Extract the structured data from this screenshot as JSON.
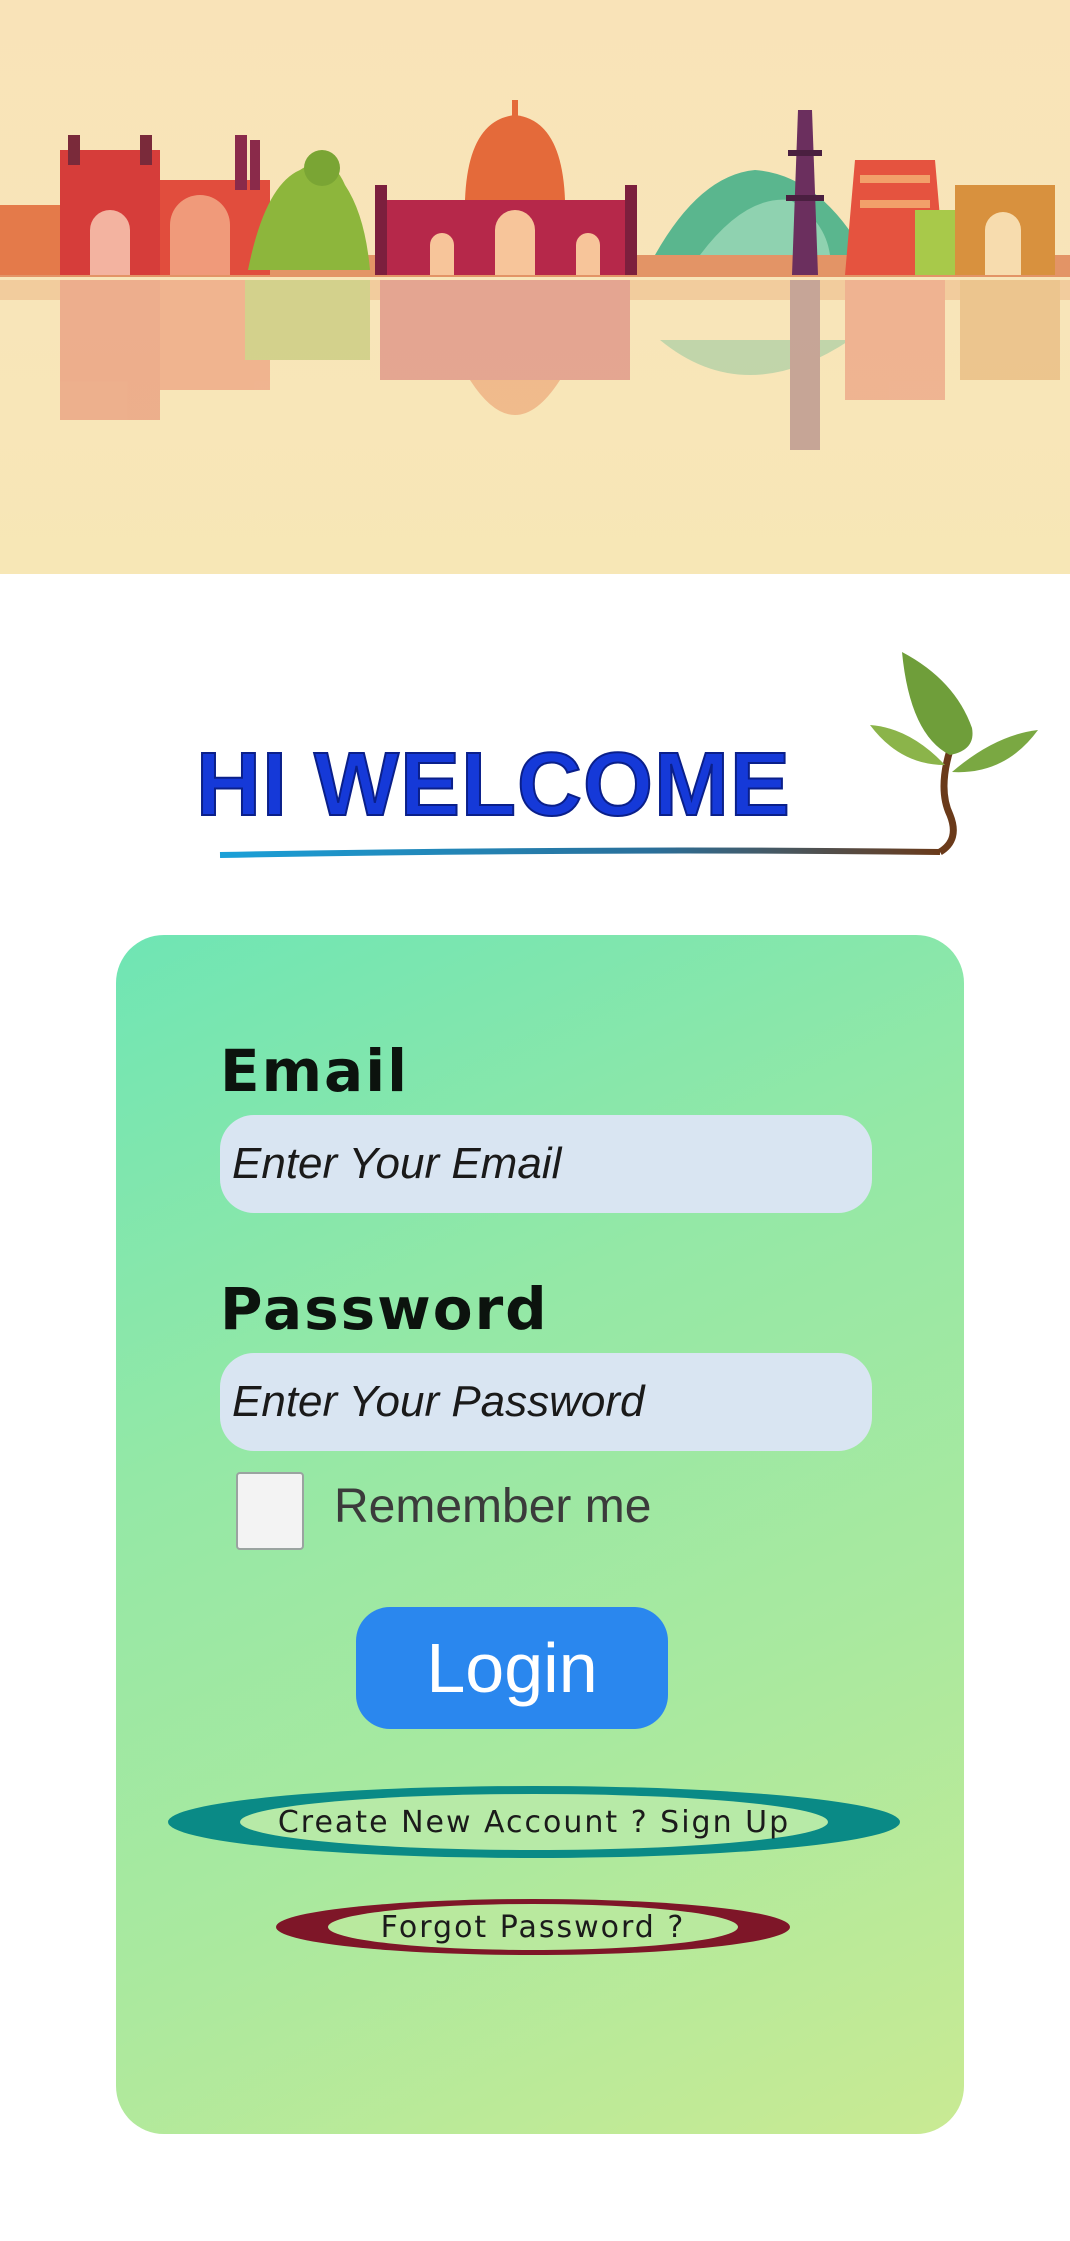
{
  "banner": {
    "icon": "india-monuments-skyline-illustration"
  },
  "welcome": {
    "title": "HI WELCOME",
    "icon": "leaf-sprout-icon"
  },
  "form": {
    "email_label": "Email",
    "email_placeholder": "Enter Your Email",
    "email_value": "",
    "password_label": "Password",
    "password_placeholder": "Enter Your Password",
    "password_value": "",
    "remember_label": "Remember me",
    "remember_checked": false,
    "login_label": "Login",
    "signup_label": "Create New Account ? Sign Up",
    "forgot_label": "Forgot Password ?"
  },
  "colors": {
    "title": "#1539d8",
    "login_button": "#2a87ee",
    "signup_ring": "#0a8a86",
    "forgot_ring": "#7e1628",
    "input_bg": "#d9e5f2"
  }
}
